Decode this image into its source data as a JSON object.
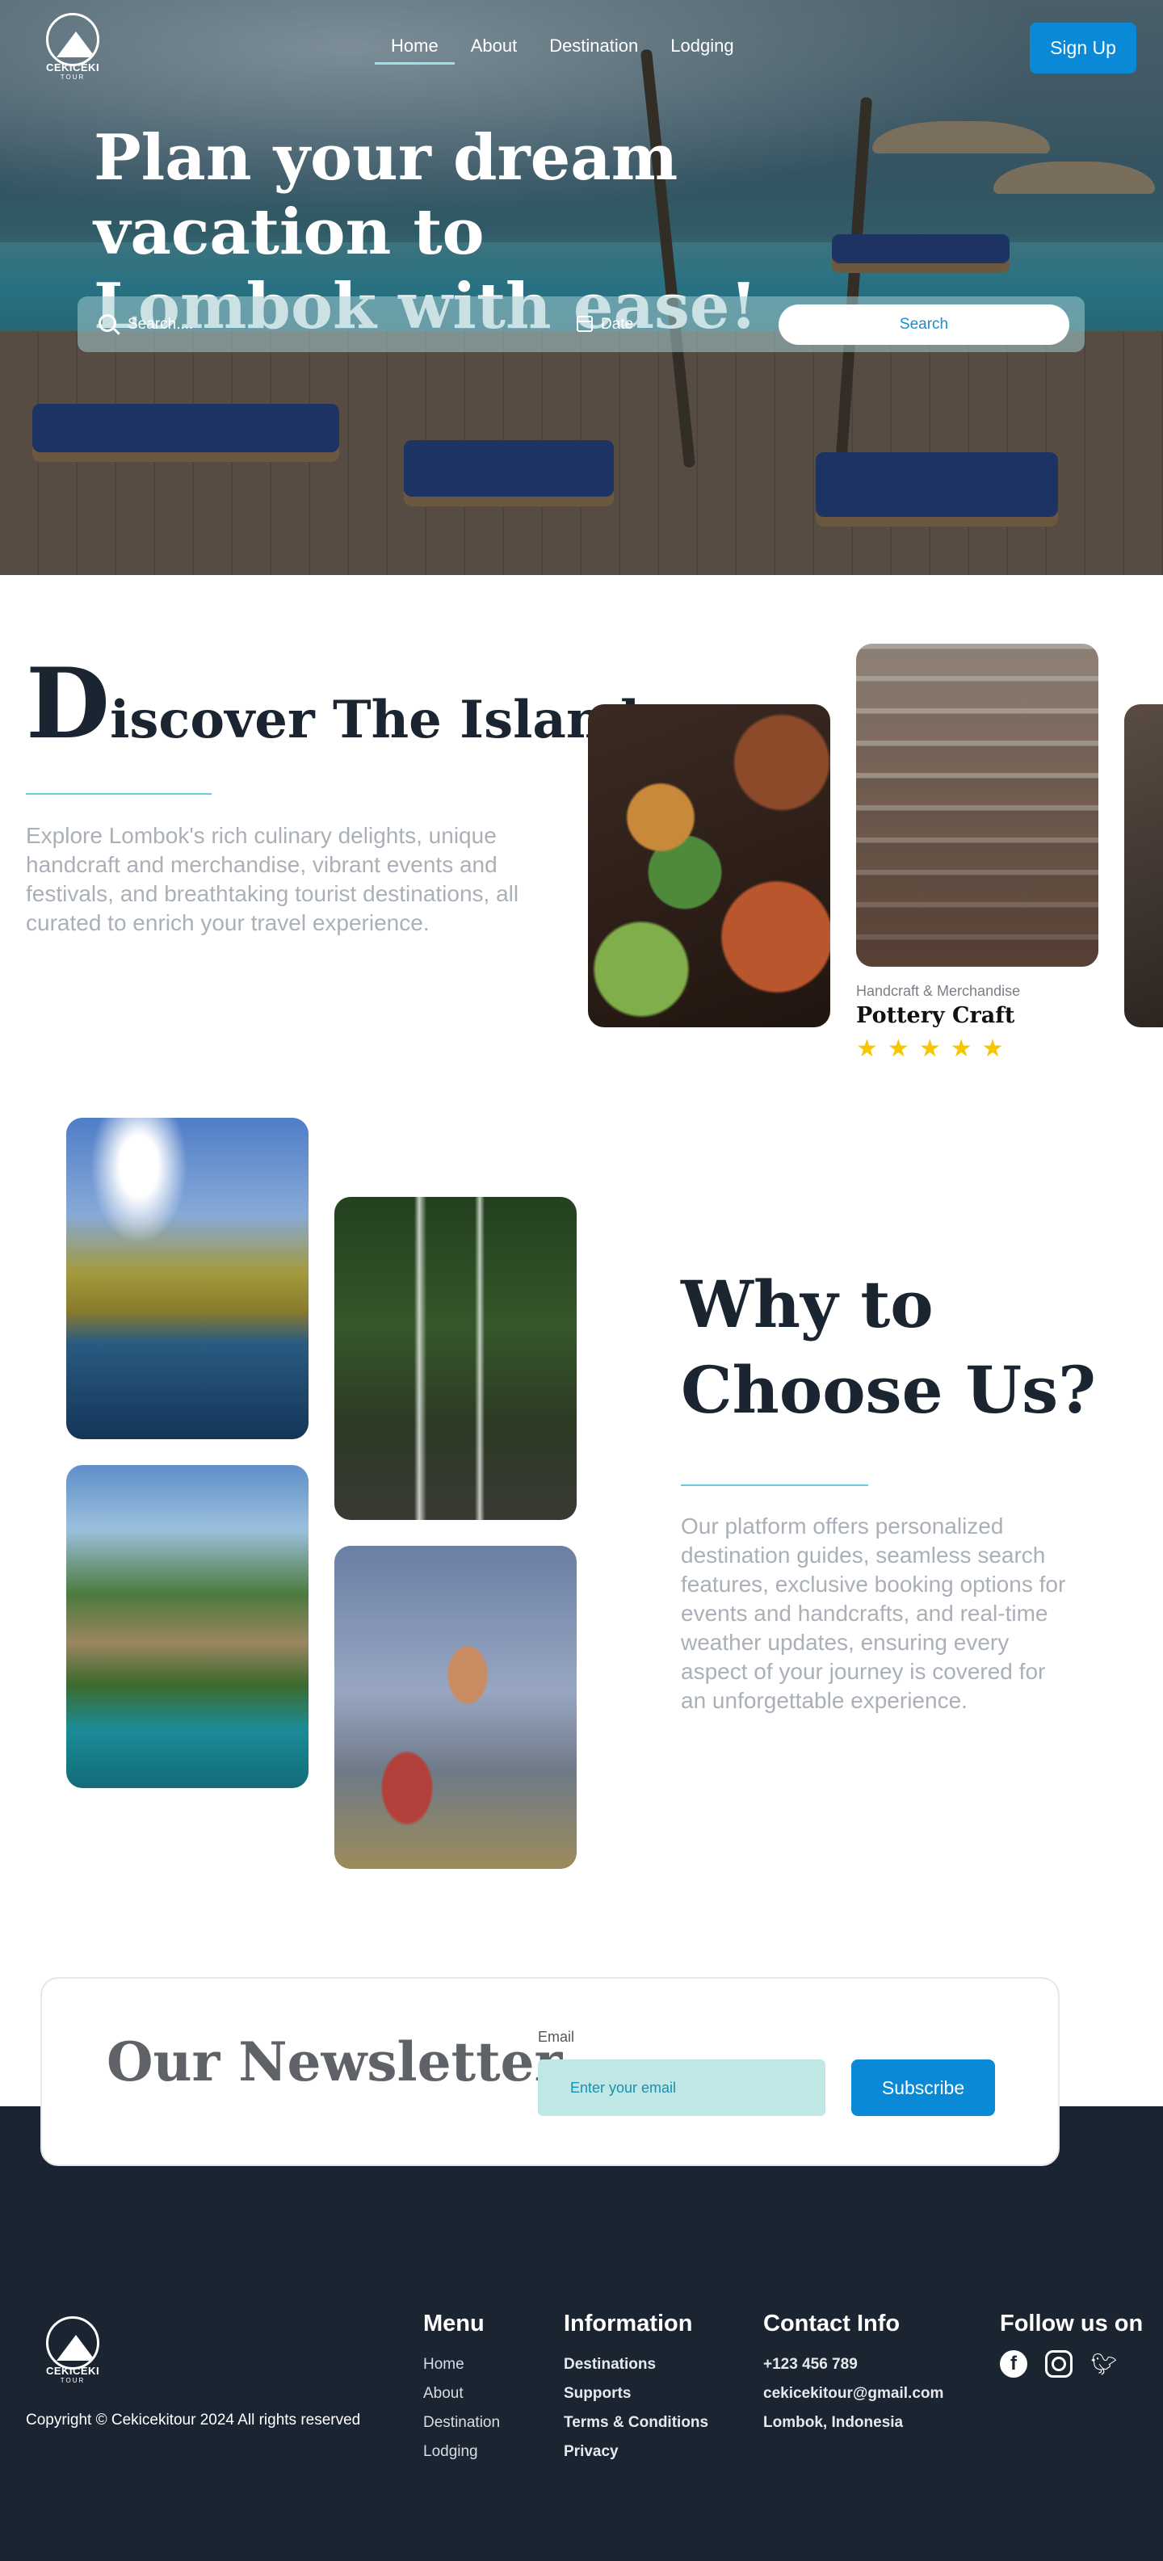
{
  "brand": {
    "name": "CEKICEKI",
    "tagline": "TOUR"
  },
  "nav": {
    "links": [
      {
        "label": "Home",
        "active": true
      },
      {
        "label": "About",
        "active": false
      },
      {
        "label": "Destination",
        "active": false
      },
      {
        "label": "Lodging",
        "active": false
      }
    ],
    "signup_label": "Sign Up"
  },
  "hero": {
    "title_line1": "Plan your dream vacation to",
    "title_line2": "Lombok with ease!",
    "search_placeholder": "Search....",
    "date_label": "Date",
    "search_button": "Search"
  },
  "discover": {
    "title_initial": "D",
    "title_rest": "iscover The Island",
    "text": "Explore Lombok's rich culinary delights, unique handcraft and merchandise, vibrant events and festivals, and breathtaking tourist destinations, all curated to enrich your travel experience.",
    "card": {
      "category": "Handcraft & Merchandise",
      "name": "Pottery Craft",
      "rating": 5
    }
  },
  "why": {
    "title": "Why to Choose Us?",
    "text": "Our platform offers personalized destination guides, seamless search features, exclusive booking options for events and handcrafts, and real-time weather updates, ensuring every aspect of your journey is covered for an unforgettable experience."
  },
  "newsletter": {
    "title": "Our Newsletter",
    "email_label": "Email",
    "email_placeholder": "Enter your email",
    "button": "Subscribe"
  },
  "footer": {
    "copyright": "Copyright © Cekicekitour 2024 All rights reserved",
    "menu": {
      "title": "Menu",
      "items": [
        "Home",
        "About",
        "Destination",
        "Lodging"
      ]
    },
    "information": {
      "title": "Information",
      "items": [
        "Destinations",
        "Supports",
        "Terms & Conditions",
        "Privacy"
      ]
    },
    "contact": {
      "title": "Contact Info",
      "items": [
        "+123 456 789",
        "cekicekitour@gmail.com",
        "Lombok, Indonesia"
      ]
    },
    "follow": {
      "title": "Follow us on",
      "icons": [
        "facebook-icon",
        "instagram-icon",
        "twitter-icon"
      ]
    }
  },
  "colors": {
    "accent": "#0a8ad6",
    "footer": "#1b2532",
    "star": "#f6c600",
    "underline": "#6ec9e0"
  }
}
